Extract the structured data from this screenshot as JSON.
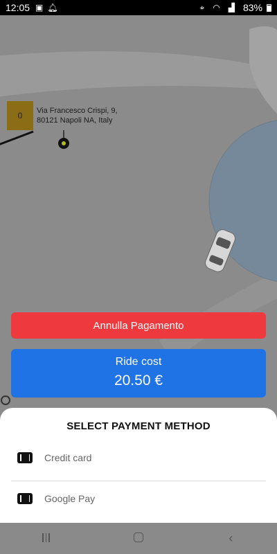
{
  "status_bar": {
    "time": "12:05",
    "battery": "83%",
    "icons": [
      "image-icon",
      "notification-bell-icon",
      "location-icon",
      "wifi-icon",
      "signal-icon",
      "battery-icon"
    ]
  },
  "map": {
    "address_badge": "0",
    "address": "Via Francesco Crispi, 9, 80121 Napoli NA, Italy"
  },
  "cancel_button": {
    "label": "Annulla Pagamento"
  },
  "ride_cost": {
    "label": "Ride cost",
    "amount": "20.50 €"
  },
  "payment_sheet": {
    "title": "SELECT PAYMENT METHOD",
    "methods": [
      {
        "label": "Credit card",
        "icon": "card-icon"
      },
      {
        "label": "Google Pay",
        "icon": "card-icon"
      }
    ]
  },
  "colors": {
    "cancel": "#ee3a3f",
    "ride_cost": "#1f73e4",
    "badge": "#8a6d15"
  }
}
